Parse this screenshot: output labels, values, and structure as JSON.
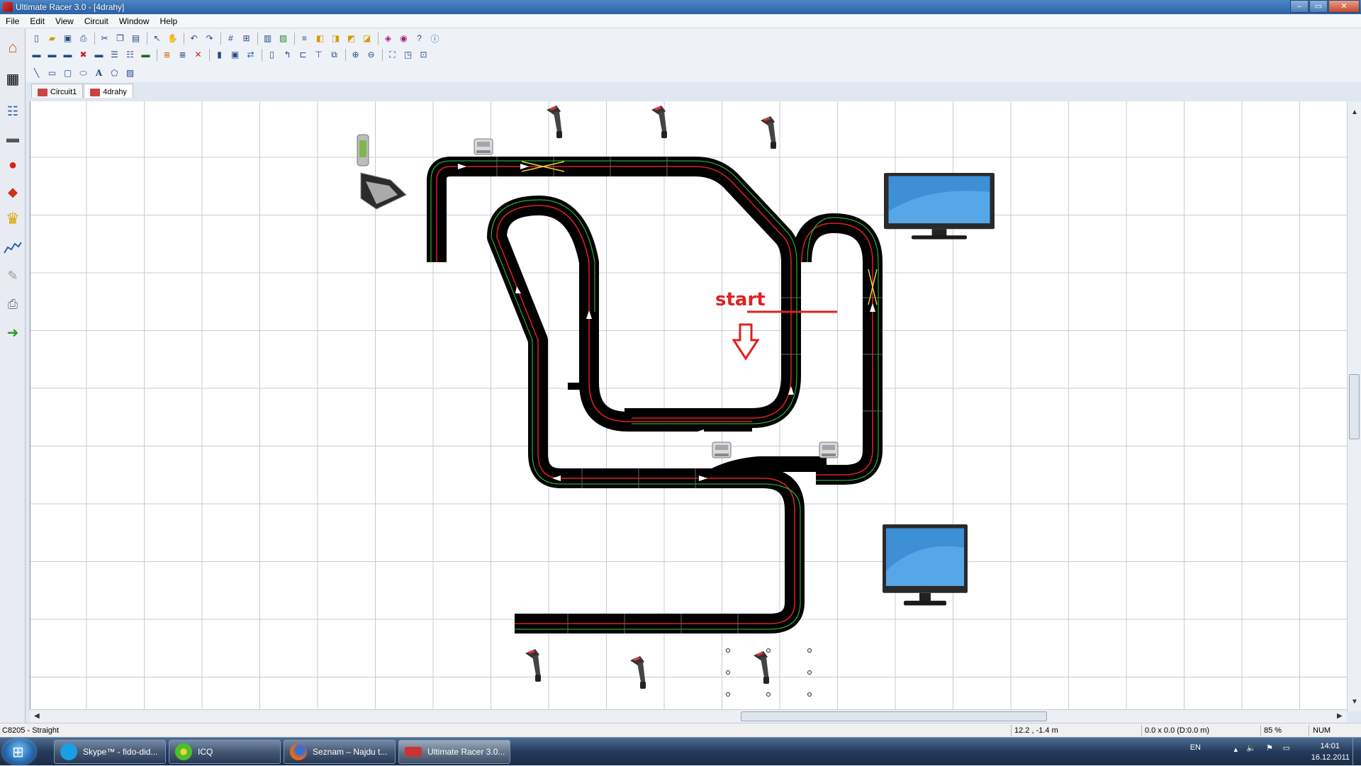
{
  "window": {
    "title": "Ultimate Racer 3.0 - [4drahy]",
    "controls": [
      "–",
      "▭",
      "✕"
    ]
  },
  "menu": [
    "File",
    "Edit",
    "View",
    "Circuit",
    "Window",
    "Help"
  ],
  "toolbar": {
    "row1_icons": [
      "new-icon",
      "open-icon",
      "save-icon",
      "print-icon",
      "cut-icon",
      "copy-icon",
      "paste-icon",
      "select-icon",
      "pan-icon",
      "undo-icon",
      "redo-icon",
      "grid-icon",
      "snap-icon",
      "layer-icon",
      "image-icon",
      "align-left-icon",
      "bring-front-icon",
      "send-back-icon",
      "group-icon",
      "ungroup-icon",
      "track-lib-icon",
      "preview-icon",
      "help-icon",
      "about-icon"
    ],
    "row2_icons": [
      "straight-track-icon",
      "curve-track-icon",
      "crossover-icon",
      "lane-change-icon",
      "border-icon",
      "barrier-icon",
      "pitlane-icon",
      "bridge-icon",
      "stripes-icon",
      "double-stripes-icon",
      "delete-track-icon",
      "column-icon",
      "camera-icon",
      "connect-icon",
      "rect-select-icon",
      "rotate-left-icon",
      "rotate-right-icon",
      "flip-icon",
      "mirror-icon",
      "zoom-in-icon",
      "zoom-out-icon",
      "zoom-fit-icon",
      "zoom-window-icon",
      "center-icon"
    ],
    "row3_icons": [
      "line-tool-icon",
      "rect-tool-icon",
      "rounded-rect-tool-icon",
      "ellipse-tool-icon",
      "text-tool-icon",
      "polygon-tool-icon",
      "image-tool-icon"
    ],
    "row3_text_glyph": "A"
  },
  "tabs": [
    {
      "label": "Circuit1"
    },
    {
      "label": "4drahy"
    }
  ],
  "sidebar_icons": [
    "home-icon",
    "race-flag-icon",
    "drivers-icon",
    "car-icon",
    "race-car-icon",
    "gearbox-icon",
    "trophy-icon",
    "chart-icon",
    "pen-icon",
    "printer-icon",
    "exit-icon"
  ],
  "canvas": {
    "annotation": "start",
    "annotation_color": "#dd2222",
    "track_color": "#000000",
    "lane_colors": [
      "#e02020",
      "#30d040"
    ]
  },
  "statusbar": {
    "item": "C8205 - Straight",
    "coords": "12.2 , -1.4 m",
    "size": "0.0 x 0.0  (D:0.0 m)",
    "zoom": "85 %",
    "numlock": "NUM"
  },
  "taskbar": {
    "tasks": [
      {
        "label": "Skype™ - fido-did..."
      },
      {
        "label": "ICQ"
      },
      {
        "label": "Seznam – Najdu t..."
      },
      {
        "label": "Ultimate Racer 3.0..."
      }
    ],
    "lang": "EN",
    "time": "14:01",
    "date": "16.12.2011"
  }
}
